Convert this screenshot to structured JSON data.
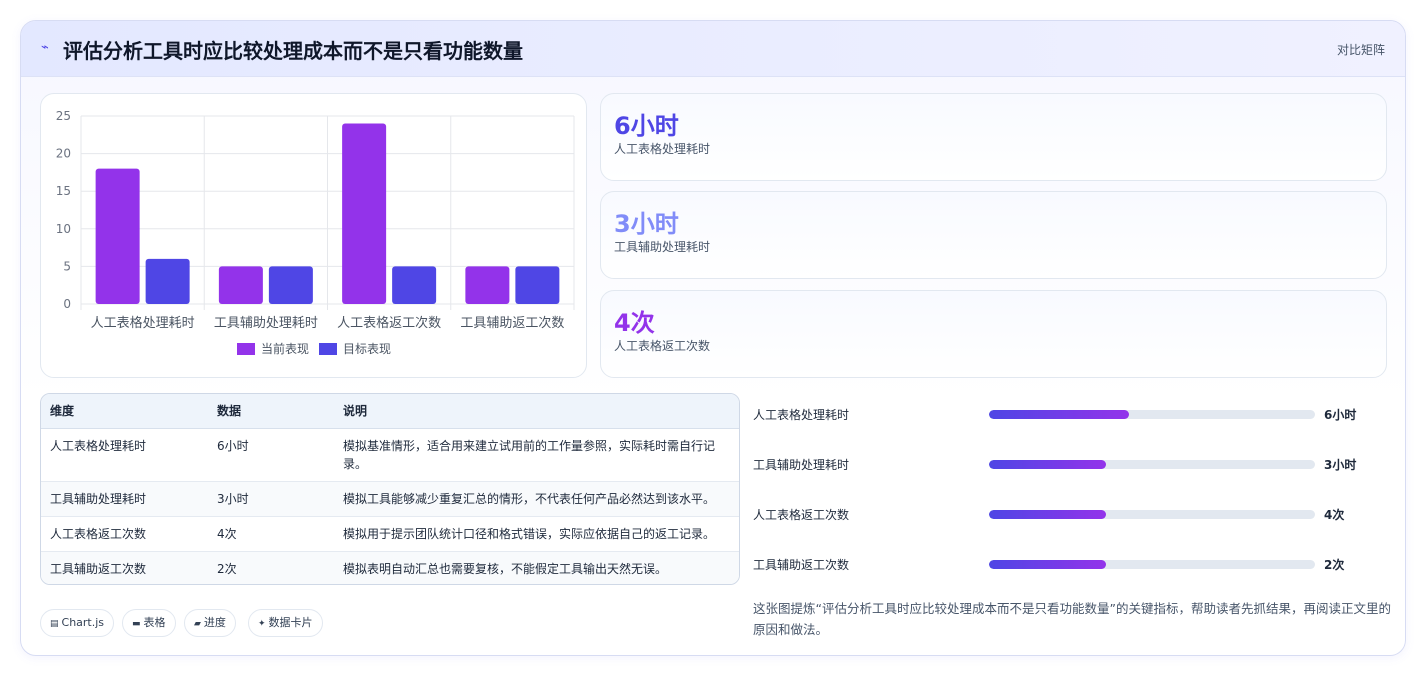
{
  "header": {
    "icon": "sparkle-line-icon",
    "title": "评估分析工具时应比较处理成本而不是只看功能数量",
    "link": "对比矩阵"
  },
  "chart_data": {
    "type": "bar",
    "categories": [
      "人工表格处理耗时",
      "工具辅助处理耗时",
      "人工表格返工次数",
      "工具辅助返工次数"
    ],
    "series": [
      {
        "name": "当前表现",
        "values": [
          18,
          5,
          24,
          5
        ],
        "color": "#9333ea"
      },
      {
        "name": "目标表现",
        "values": [
          6,
          5,
          5,
          5
        ],
        "color": "#4f46e5"
      }
    ],
    "ylim": [
      0,
      25
    ],
    "yticks": [
      0,
      5,
      10,
      15,
      20,
      25
    ],
    "grid": true,
    "legend": "bottom"
  },
  "stats": [
    {
      "value": "6小时",
      "label": "人工表格处理耗时",
      "color": "#4f46e5"
    },
    {
      "value": "3小时",
      "label": "工具辅助处理耗时",
      "color": "#818cf8"
    },
    {
      "value": "4次",
      "label": "人工表格返工次数",
      "color": "#9333ea"
    }
  ],
  "table": {
    "headers": [
      "维度",
      "数据",
      "说明"
    ],
    "rows": [
      [
        "人工表格处理耗时",
        "6小时",
        "模拟基准情形，适合用来建立试用前的工作量参照，实际耗时需自行记录。"
      ],
      [
        "工具辅助处理耗时",
        "3小时",
        "模拟工具能够减少重复汇总的情形，不代表任何产品必然达到该水平。"
      ],
      [
        "人工表格返工次数",
        "4次",
        "模拟用于提示团队统计口径和格式错误，实际应依据自己的返工记录。"
      ],
      [
        "工具辅助返工次数",
        "2次",
        "模拟表明自动汇总也需要复核，不能假定工具输出天然无误。"
      ]
    ]
  },
  "progress": [
    {
      "label": "人工表格处理耗时",
      "value": "6小时",
      "fraction": 0.43
    },
    {
      "label": "工具辅助处理耗时",
      "value": "3小时",
      "fraction": 0.36
    },
    {
      "label": "人工表格返工次数",
      "value": "4次",
      "fraction": 0.36
    },
    {
      "label": "工具辅助返工次数",
      "value": "2次",
      "fraction": 0.36
    }
  ],
  "summary": "这张图提炼“评估分析工具时应比较处理成本而不是只看功能数量”的关键指标，帮助读者先抓结果，再阅读正文里的原因和做法。",
  "tags": [
    {
      "icon": "chart-icon",
      "label": "Chart.js"
    },
    {
      "icon": "table-icon",
      "label": "表格"
    },
    {
      "icon": "progress-icon",
      "label": "进度"
    },
    {
      "icon": "sparkle-icon",
      "label": "数据卡片"
    }
  ]
}
